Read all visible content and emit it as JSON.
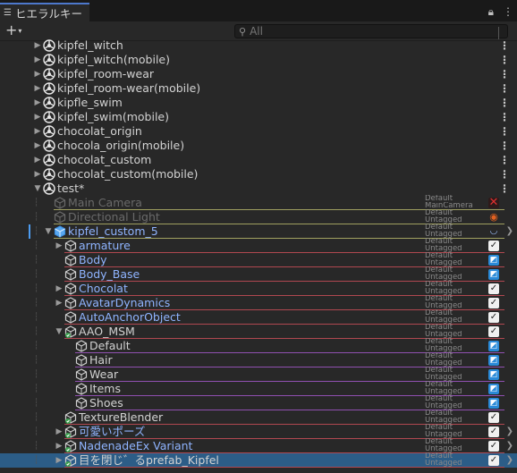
{
  "window": {
    "tab_title": "ヒエラルキー"
  },
  "toolbar": {
    "add_label": "+",
    "search_placeholder": "All"
  },
  "rows": [
    {
      "indent": 0,
      "arrow": "right",
      "icon": "unity",
      "name": "kipfel_witch",
      "style": "normal",
      "kebab": true
    },
    {
      "indent": 0,
      "arrow": "right",
      "icon": "unity",
      "name": "kipfel_witch(mobile)",
      "style": "normal",
      "kebab": true
    },
    {
      "indent": 0,
      "arrow": "right",
      "icon": "unity",
      "name": "kipfel_room-wear",
      "style": "normal",
      "kebab": true
    },
    {
      "indent": 0,
      "arrow": "right",
      "icon": "unity",
      "name": "kipfel_room-wear(mobile)",
      "style": "normal",
      "kebab": true
    },
    {
      "indent": 0,
      "arrow": "right",
      "icon": "unity",
      "name": "kipfle_swim",
      "style": "normal",
      "kebab": true
    },
    {
      "indent": 0,
      "arrow": "right",
      "icon": "unity",
      "name": "kipfel_swim(mobile)",
      "style": "normal",
      "kebab": true
    },
    {
      "indent": 0,
      "arrow": "right",
      "icon": "unity",
      "name": "chocolat_origin",
      "style": "normal",
      "kebab": true
    },
    {
      "indent": 0,
      "arrow": "right",
      "icon": "unity",
      "name": "chocola_origin(mobile)",
      "style": "normal",
      "kebab": true
    },
    {
      "indent": 0,
      "arrow": "right",
      "icon": "unity",
      "name": "chocolat_custom",
      "style": "normal",
      "kebab": true
    },
    {
      "indent": 0,
      "arrow": "right",
      "icon": "unity",
      "name": "chocolat_custom(mobile)",
      "style": "normal",
      "kebab": true
    },
    {
      "indent": 0,
      "arrow": "down",
      "icon": "unity",
      "name": "test*",
      "style": "normal",
      "kebab": true
    },
    {
      "indent": 1,
      "arrow": "none",
      "icon": "cube-gray",
      "name": "Main Camera",
      "style": "inactive",
      "tag1": "Default",
      "tag2": "MainCamera",
      "line": "#a0a060",
      "check": "red"
    },
    {
      "indent": 1,
      "arrow": "none",
      "icon": "cube-gray",
      "name": "Directional Light",
      "style": "inactive",
      "tag1": "Default",
      "tag2": "Untagged",
      "line": "#a0a060",
      "check": "warn"
    },
    {
      "indent": 1,
      "arrow": "down",
      "icon": "cube-blue",
      "name": "kipfel_custom_5",
      "style": "prefab",
      "tag1": "Default",
      "tag2": "Untagged",
      "line": "#a0a060",
      "check": "blue",
      "chev": true,
      "selbar": true
    },
    {
      "indent": 2,
      "arrow": "right",
      "icon": "cube-outline",
      "name": "armature",
      "style": "prefab",
      "tag1": "Default",
      "tag2": "Untagged",
      "line": "#b04850",
      "check": "check"
    },
    {
      "indent": 2,
      "arrow": "none",
      "icon": "cube-outline",
      "name": "Body",
      "style": "prefab",
      "tag1": "Default",
      "tag2": "Untagged",
      "line": "#b04850",
      "check": "mixed"
    },
    {
      "indent": 2,
      "arrow": "none",
      "icon": "cube-outline",
      "name": "Body_Base",
      "style": "prefab",
      "tag1": "Default",
      "tag2": "Untagged",
      "line": "#b04850",
      "check": "mixed"
    },
    {
      "indent": 2,
      "arrow": "right",
      "icon": "cube-outline",
      "name": "Chocolat",
      "style": "prefab",
      "tag1": "Default",
      "tag2": "Untagged",
      "line": "#b04850",
      "check": "check"
    },
    {
      "indent": 2,
      "arrow": "right",
      "icon": "cube-outline",
      "name": "AvatarDynamics",
      "style": "prefab",
      "tag1": "Default",
      "tag2": "Untagged",
      "line": "#b04850",
      "check": "check"
    },
    {
      "indent": 2,
      "arrow": "none",
      "icon": "cube-outline",
      "name": "AutoAnchorObject",
      "style": "prefab",
      "tag1": "Default",
      "tag2": "Untagged",
      "line": "#b04850",
      "check": "check"
    },
    {
      "indent": 2,
      "arrow": "down",
      "icon": "cube-green",
      "name": "AAO_MSM",
      "style": "normal",
      "tag1": "Default",
      "tag2": "Untagged",
      "line": "#b04850",
      "check": "check"
    },
    {
      "indent": 3,
      "arrow": "none",
      "icon": "cube-outline",
      "name": "Default",
      "style": "normal",
      "tag1": "Default",
      "tag2": "Untagged",
      "line": "#9050b0",
      "check": "mixed"
    },
    {
      "indent": 3,
      "arrow": "none",
      "icon": "cube-outline",
      "name": "Hair",
      "style": "normal",
      "tag1": "Default",
      "tag2": "Untagged",
      "line": "#9050b0",
      "check": "mixed"
    },
    {
      "indent": 3,
      "arrow": "none",
      "icon": "cube-outline",
      "name": "Wear",
      "style": "normal",
      "tag1": "Default",
      "tag2": "Untagged",
      "line": "#9050b0",
      "check": "mixed"
    },
    {
      "indent": 3,
      "arrow": "none",
      "icon": "cube-outline",
      "name": "Items",
      "style": "normal",
      "tag1": "Default",
      "tag2": "Untagged",
      "line": "#9050b0",
      "check": "mixed"
    },
    {
      "indent": 3,
      "arrow": "none",
      "icon": "cube-outline",
      "name": "Shoes",
      "style": "normal",
      "tag1": "Default",
      "tag2": "Untagged",
      "line": "#9050b0",
      "check": "mixed"
    },
    {
      "indent": 2,
      "arrow": "none",
      "icon": "cube-green",
      "name": "TextureBlender",
      "style": "normal",
      "tag1": "Default",
      "tag2": "Untagged",
      "line": "#b04850",
      "check": "check"
    },
    {
      "indent": 2,
      "arrow": "right",
      "icon": "cube-green",
      "name": "可愛いポーズ",
      "style": "prefab",
      "tag1": "Default",
      "tag2": "Untagged",
      "line": "#b04850",
      "check": "check",
      "chev": true
    },
    {
      "indent": 2,
      "arrow": "right",
      "icon": "cube-green",
      "name": "NadenadeEx Variant",
      "style": "prefab",
      "tag1": "Default",
      "tag2": "Untagged",
      "line": "#b04850",
      "check": "check",
      "chev": true
    },
    {
      "indent": 2,
      "arrow": "right",
      "icon": "cube-green",
      "name": "目を閉じ゛るprefab_Kipfel",
      "style": "normal",
      "tag1": "Default",
      "tag2": "Untagged",
      "line": "#b04850",
      "check": "check",
      "chev": true,
      "selected": true
    }
  ]
}
